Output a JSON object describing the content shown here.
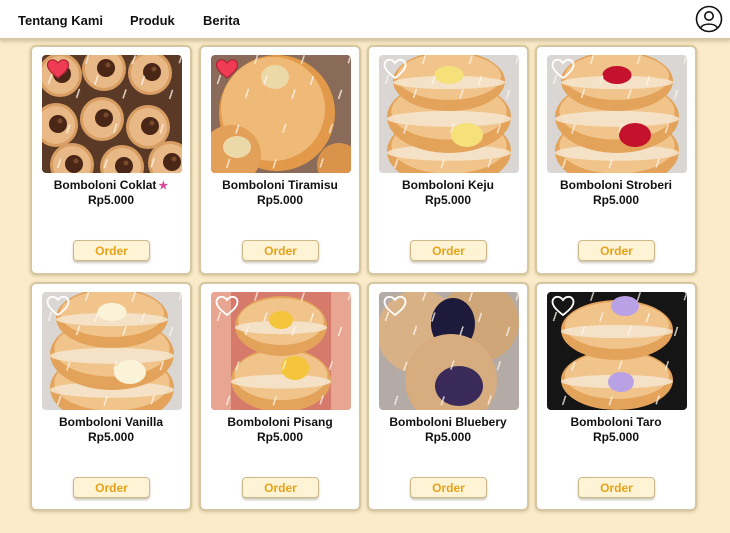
{
  "nav": {
    "links": [
      "Tentang Kami",
      "Produk",
      "Berita"
    ],
    "profile_icon": "user-circle-icon"
  },
  "colors": {
    "background": "#fbebc9",
    "order_text": "#e8a21a",
    "heart_active": "#ef3b54"
  },
  "products": [
    {
      "name": "Bomboloni Coklat",
      "price": "Rp5.000",
      "order_label": "Order",
      "favorited": true,
      "featured_icon": "star-icon",
      "filling": "#4a2616",
      "style": "grid"
    },
    {
      "name": "Bomboloni Tiramisu",
      "price": "Rp5.000",
      "order_label": "Order",
      "favorited": true,
      "filling": "#ecd9a8",
      "style": "top"
    },
    {
      "name": "Bomboloni Keju",
      "price": "Rp5.000",
      "order_label": "Order",
      "favorited": false,
      "filling": "#f5e07a",
      "style": "stack"
    },
    {
      "name": "Bomboloni Stroberi",
      "price": "Rp5.000",
      "order_label": "Order",
      "favorited": false,
      "filling": "#c4122c",
      "style": "stack"
    },
    {
      "name": "Bomboloni Vanilla",
      "price": "Rp5.000",
      "order_label": "Order",
      "favorited": false,
      "filling": "#fbf3d8",
      "style": "stack"
    },
    {
      "name": "Bomboloni Pisang",
      "price": "Rp5.000",
      "order_label": "Order",
      "favorited": false,
      "filling": "#f4c53a",
      "style": "hand"
    },
    {
      "name": "Bomboloni Bluebery",
      "price": "Rp5.000",
      "order_label": "Order",
      "favorited": false,
      "filling": "#1e1a3c",
      "style": "blue"
    },
    {
      "name": "Bomboloni Taro",
      "price": "Rp5.000",
      "order_label": "Order",
      "favorited": false,
      "filling": "#b9a1e6",
      "style": "dark"
    }
  ]
}
